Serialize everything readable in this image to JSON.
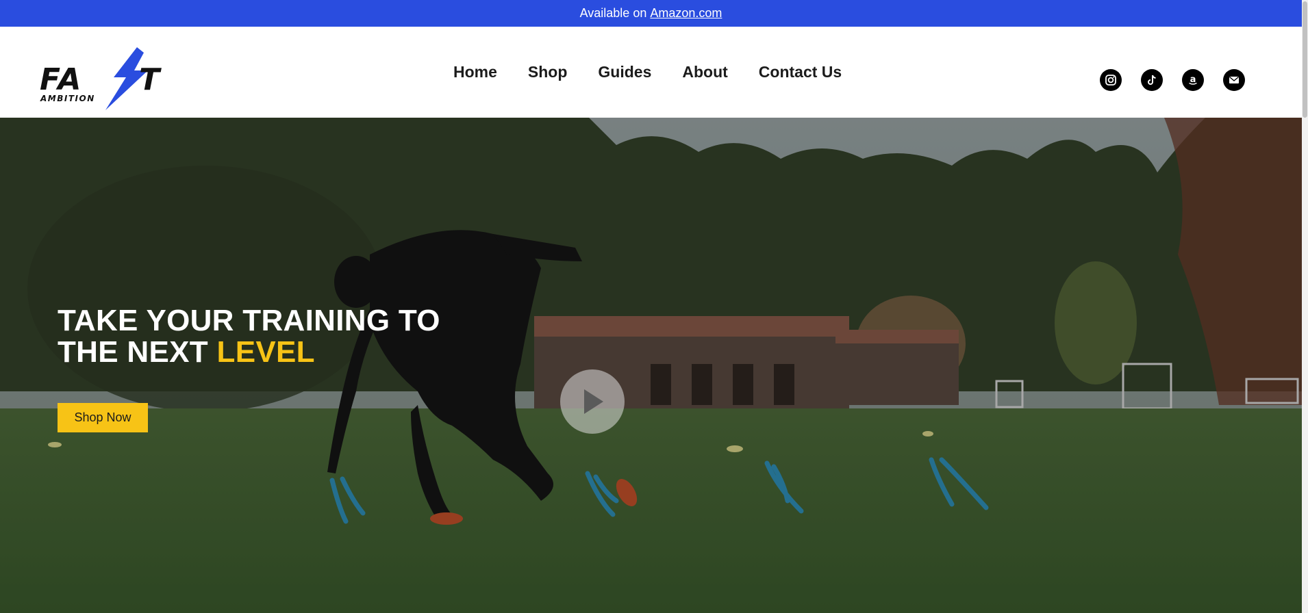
{
  "announcement": {
    "prefix": "Available on",
    "link_text": "Amazon.com"
  },
  "brand": {
    "logo_word": "FAST",
    "logo_sub": "AMBITION",
    "accent_color": "#2a4ddf"
  },
  "nav": {
    "items": [
      "Home",
      "Shop",
      "Guides",
      "About",
      "Contact Us"
    ]
  },
  "socials": [
    "instagram-icon",
    "tiktok-icon",
    "amazon-icon",
    "mail-icon"
  ],
  "hero": {
    "headline_line1": "TAKE YOUR TRAINING TO",
    "headline_line2_prefix": "THE NEXT",
    "headline_line2_accent": "LEVEL",
    "cta_label": "Shop Now",
    "accent_color": "#f7c316"
  }
}
